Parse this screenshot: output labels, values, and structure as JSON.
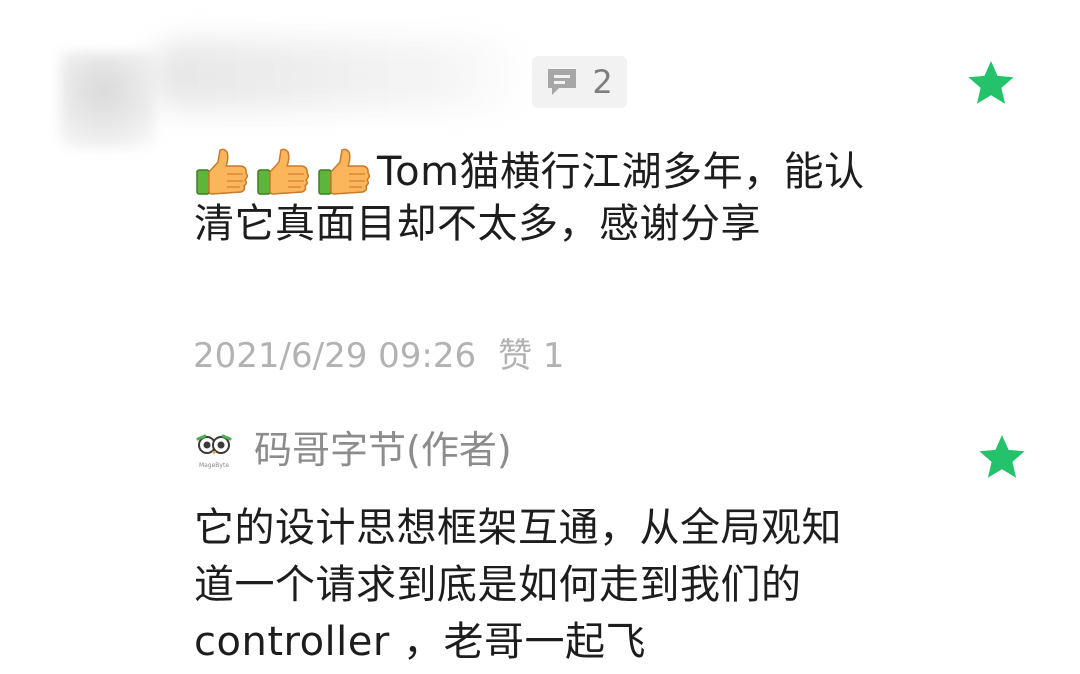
{
  "comments": [
    {
      "reply_count": "2",
      "reactions": [
        "thumbs-up",
        "thumbs-up",
        "thumbs-up"
      ],
      "text": "Tom猫横行江湖多年，能认清它真面目却不太多，感谢分享",
      "timestamp": "2021/6/29 09:26",
      "likes": "赞 1",
      "featured_icon": "star-icon"
    },
    {
      "author": "码哥字节(作者)",
      "author_logo_text": "MageByte",
      "text": "它的设计思想框架互通，从全局观知道一个请求到底是如何走到我们的 controller ，老哥一起飞",
      "featured_icon": "star-icon"
    }
  ],
  "colors": {
    "star": "#24c26b",
    "text": "#1d1d1d",
    "meta": "#b2b2b2",
    "author": "#8c8c8c",
    "badge_bg": "#f2f2f2"
  }
}
